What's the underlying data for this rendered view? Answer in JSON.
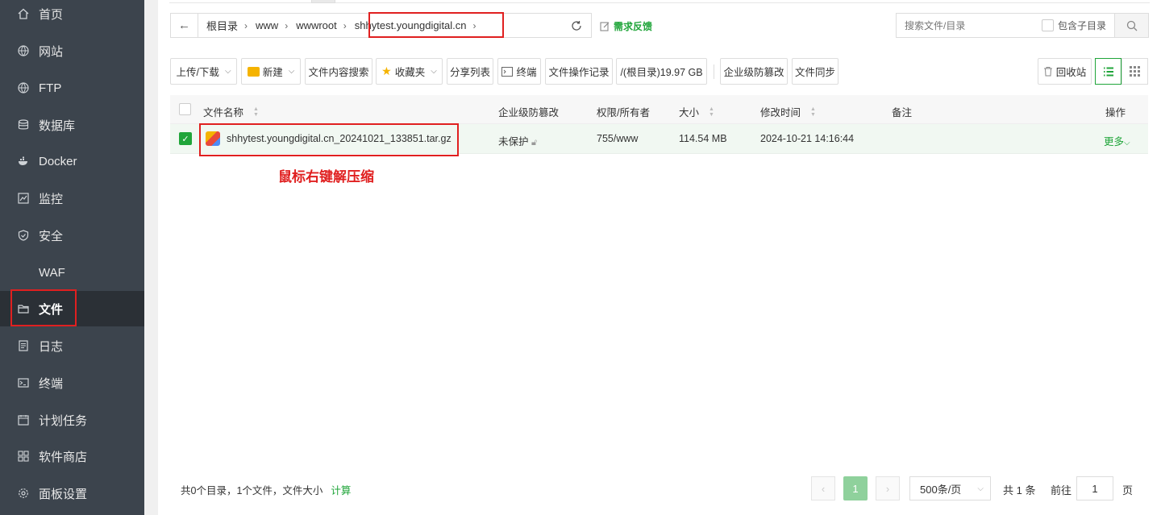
{
  "sidebar": {
    "items": [
      {
        "label": "首页",
        "icon": "home-icon"
      },
      {
        "label": "网站",
        "icon": "globe-icon"
      },
      {
        "label": "FTP",
        "icon": "globe-icon"
      },
      {
        "label": "数据库",
        "icon": "database-icon"
      },
      {
        "label": "Docker",
        "icon": "docker-icon"
      },
      {
        "label": "监控",
        "icon": "monitor-icon"
      },
      {
        "label": "安全",
        "icon": "shield-icon"
      },
      {
        "label": "WAF",
        "icon": "firewall-icon"
      },
      {
        "label": "文件",
        "icon": "folder-icon",
        "active": true
      },
      {
        "label": "日志",
        "icon": "log-icon"
      },
      {
        "label": "终端",
        "icon": "terminal-icon"
      },
      {
        "label": "计划任务",
        "icon": "calendar-icon"
      },
      {
        "label": "软件商店",
        "icon": "apps-icon"
      },
      {
        "label": "面板设置",
        "icon": "gear-icon"
      }
    ]
  },
  "pathbar": {
    "crumbs": [
      "根目录",
      "www",
      "wwwroot",
      "shhytest.youngdigital.cn"
    ]
  },
  "feedback_label": "需求反馈",
  "search": {
    "placeholder": "搜索文件/目录",
    "include_sub_label": "包含子目录"
  },
  "toolbar": {
    "upload_download": "上传/下载",
    "new": "新建",
    "content_search": "文件内容搜索",
    "favorites": "收藏夹",
    "share_list": "分享列表",
    "terminal": "终端",
    "operation_log": "文件操作记录",
    "disk_info": "/(根目录)19.97 GB",
    "tamper_proof": "企业级防篡改",
    "file_sync": "文件同步",
    "recycle_bin": "回收站"
  },
  "table": {
    "headers": {
      "name": "文件名称",
      "tamper": "企业级防篡改",
      "perm": "权限/所有者",
      "size": "大小",
      "mtime": "修改时间",
      "remark": "备注",
      "ops": "操作"
    },
    "rows": [
      {
        "name": "shhytest.youngdigital.cn_20241021_133851.tar.gz",
        "tamper": "未保护",
        "perm": "755/www",
        "size": "114.54 MB",
        "mtime": "2024-10-21 14:16:44",
        "remark": "",
        "ops": "更多"
      }
    ]
  },
  "annotation": "鼠标右键解压缩",
  "footer": {
    "summary": "共0个目录，1个文件，文件大小",
    "calc": "计算",
    "current_page": "1",
    "page_size": "500条/页",
    "total": "共 1 条",
    "goto_prefix": "前往",
    "goto_value": "1",
    "goto_suffix": "页"
  },
  "colors": {
    "accent": "#20a53a",
    "sidebar_bg": "#3c444d",
    "highlight_red": "#e02020"
  }
}
